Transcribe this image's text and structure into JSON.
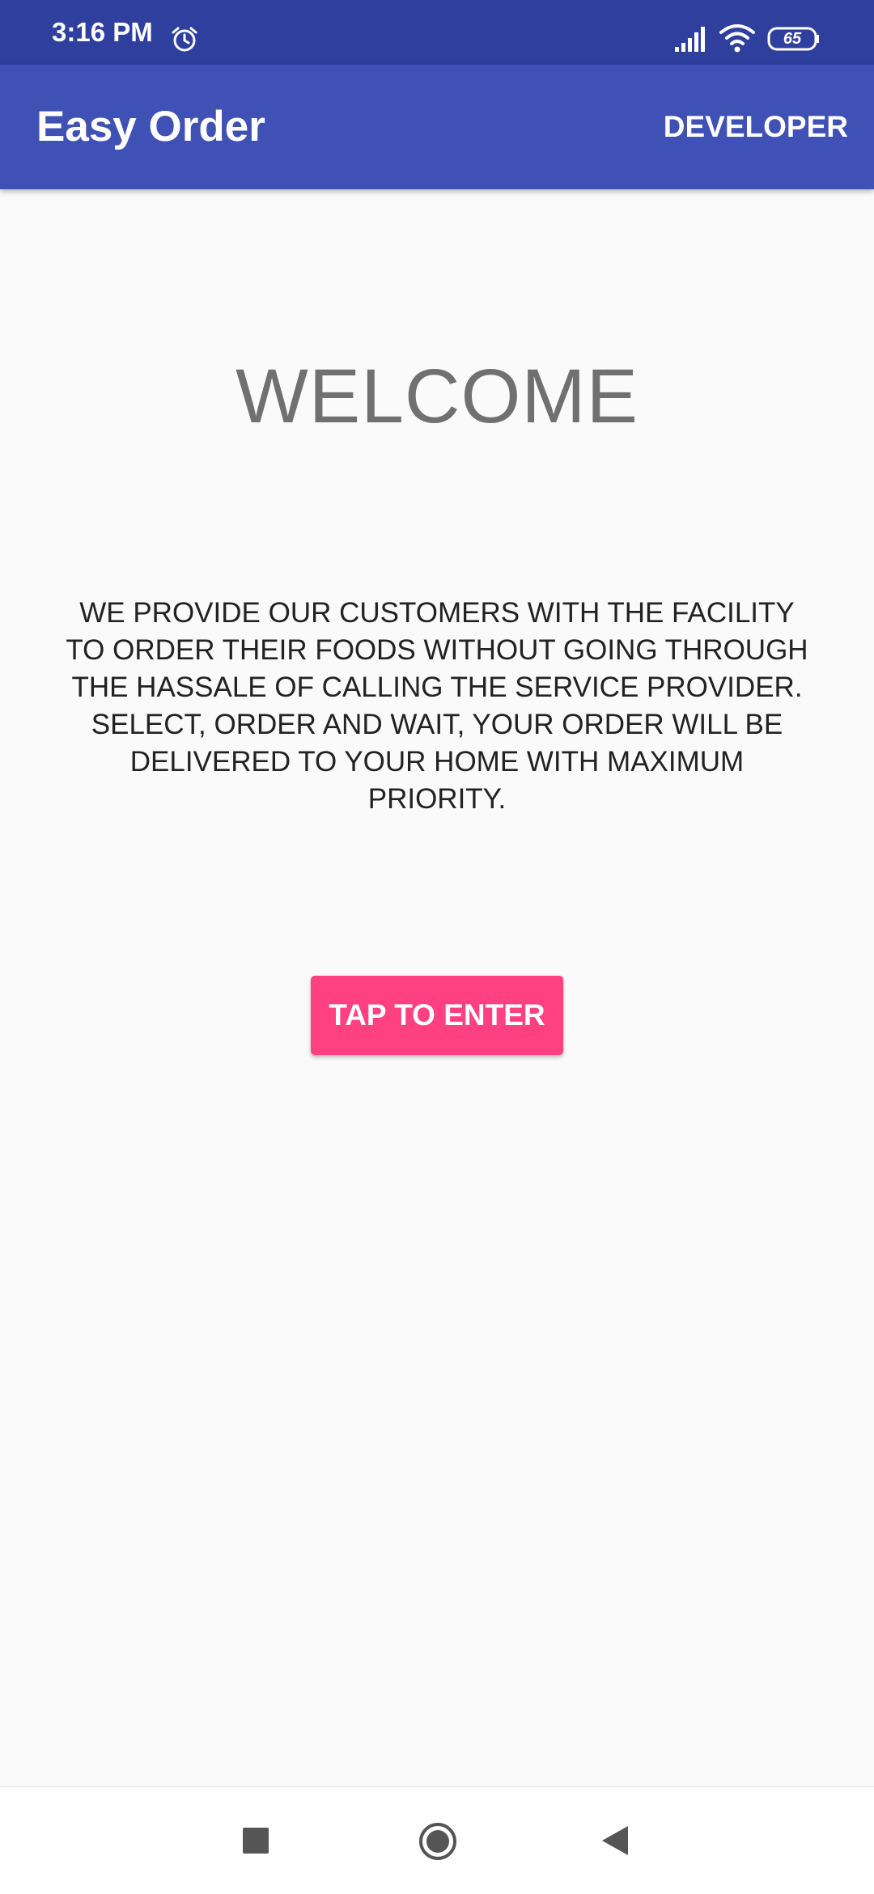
{
  "status_bar": {
    "time": "3:16 PM",
    "battery_level": "65",
    "icons": [
      "alarm-icon",
      "signal-icon",
      "wifi-icon",
      "battery-icon"
    ]
  },
  "app_bar": {
    "title": "Easy Order",
    "action_label": "DEVELOPER"
  },
  "main": {
    "heading": "WELCOME",
    "description": "WE PROVIDE OUR CUSTOMERS WITH THE FACILITY TO ORDER THEIR FOODS WITHOUT GOING THROUGH THE HASSALE OF CALLING THE SERVICE PROVIDER. SELECT, ORDER AND WAIT, YOUR ORDER WILL BE DELIVERED TO YOUR HOME WITH MAXIMUM PRIORITY.",
    "enter_button_label": "TAP TO ENTER"
  },
  "nav_bar": {
    "icons": [
      "recent-apps-icon",
      "home-icon",
      "back-icon"
    ]
  },
  "colors": {
    "status_bar": "#2f3f9e",
    "primary": "#3f51b5",
    "accent": "#ff4081",
    "background": "#fafafa"
  }
}
